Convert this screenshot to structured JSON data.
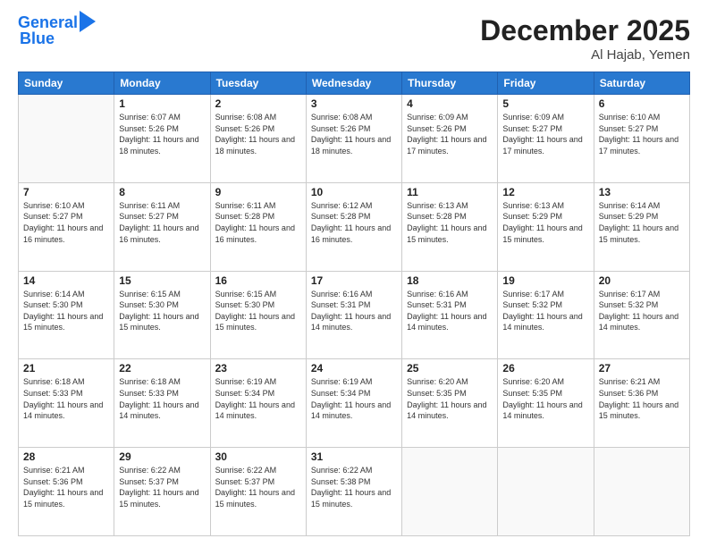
{
  "header": {
    "logo_line1": "General",
    "logo_line2": "Blue",
    "month": "December 2025",
    "location": "Al Hajab, Yemen"
  },
  "days_of_week": [
    "Sunday",
    "Monday",
    "Tuesday",
    "Wednesday",
    "Thursday",
    "Friday",
    "Saturday"
  ],
  "weeks": [
    [
      {
        "day": "",
        "info": ""
      },
      {
        "day": "1",
        "info": "Sunrise: 6:07 AM\nSunset: 5:26 PM\nDaylight: 11 hours and 18 minutes."
      },
      {
        "day": "2",
        "info": "Sunrise: 6:08 AM\nSunset: 5:26 PM\nDaylight: 11 hours and 18 minutes."
      },
      {
        "day": "3",
        "info": "Sunrise: 6:08 AM\nSunset: 5:26 PM\nDaylight: 11 hours and 18 minutes."
      },
      {
        "day": "4",
        "info": "Sunrise: 6:09 AM\nSunset: 5:26 PM\nDaylight: 11 hours and 17 minutes."
      },
      {
        "day": "5",
        "info": "Sunrise: 6:09 AM\nSunset: 5:27 PM\nDaylight: 11 hours and 17 minutes."
      },
      {
        "day": "6",
        "info": "Sunrise: 6:10 AM\nSunset: 5:27 PM\nDaylight: 11 hours and 17 minutes."
      }
    ],
    [
      {
        "day": "7",
        "info": "Sunrise: 6:10 AM\nSunset: 5:27 PM\nDaylight: 11 hours and 16 minutes."
      },
      {
        "day": "8",
        "info": "Sunrise: 6:11 AM\nSunset: 5:27 PM\nDaylight: 11 hours and 16 minutes."
      },
      {
        "day": "9",
        "info": "Sunrise: 6:11 AM\nSunset: 5:28 PM\nDaylight: 11 hours and 16 minutes."
      },
      {
        "day": "10",
        "info": "Sunrise: 6:12 AM\nSunset: 5:28 PM\nDaylight: 11 hours and 16 minutes."
      },
      {
        "day": "11",
        "info": "Sunrise: 6:13 AM\nSunset: 5:28 PM\nDaylight: 11 hours and 15 minutes."
      },
      {
        "day": "12",
        "info": "Sunrise: 6:13 AM\nSunset: 5:29 PM\nDaylight: 11 hours and 15 minutes."
      },
      {
        "day": "13",
        "info": "Sunrise: 6:14 AM\nSunset: 5:29 PM\nDaylight: 11 hours and 15 minutes."
      }
    ],
    [
      {
        "day": "14",
        "info": "Sunrise: 6:14 AM\nSunset: 5:30 PM\nDaylight: 11 hours and 15 minutes."
      },
      {
        "day": "15",
        "info": "Sunrise: 6:15 AM\nSunset: 5:30 PM\nDaylight: 11 hours and 15 minutes."
      },
      {
        "day": "16",
        "info": "Sunrise: 6:15 AM\nSunset: 5:30 PM\nDaylight: 11 hours and 15 minutes."
      },
      {
        "day": "17",
        "info": "Sunrise: 6:16 AM\nSunset: 5:31 PM\nDaylight: 11 hours and 14 minutes."
      },
      {
        "day": "18",
        "info": "Sunrise: 6:16 AM\nSunset: 5:31 PM\nDaylight: 11 hours and 14 minutes."
      },
      {
        "day": "19",
        "info": "Sunrise: 6:17 AM\nSunset: 5:32 PM\nDaylight: 11 hours and 14 minutes."
      },
      {
        "day": "20",
        "info": "Sunrise: 6:17 AM\nSunset: 5:32 PM\nDaylight: 11 hours and 14 minutes."
      }
    ],
    [
      {
        "day": "21",
        "info": "Sunrise: 6:18 AM\nSunset: 5:33 PM\nDaylight: 11 hours and 14 minutes."
      },
      {
        "day": "22",
        "info": "Sunrise: 6:18 AM\nSunset: 5:33 PM\nDaylight: 11 hours and 14 minutes."
      },
      {
        "day": "23",
        "info": "Sunrise: 6:19 AM\nSunset: 5:34 PM\nDaylight: 11 hours and 14 minutes."
      },
      {
        "day": "24",
        "info": "Sunrise: 6:19 AM\nSunset: 5:34 PM\nDaylight: 11 hours and 14 minutes."
      },
      {
        "day": "25",
        "info": "Sunrise: 6:20 AM\nSunset: 5:35 PM\nDaylight: 11 hours and 14 minutes."
      },
      {
        "day": "26",
        "info": "Sunrise: 6:20 AM\nSunset: 5:35 PM\nDaylight: 11 hours and 14 minutes."
      },
      {
        "day": "27",
        "info": "Sunrise: 6:21 AM\nSunset: 5:36 PM\nDaylight: 11 hours and 15 minutes."
      }
    ],
    [
      {
        "day": "28",
        "info": "Sunrise: 6:21 AM\nSunset: 5:36 PM\nDaylight: 11 hours and 15 minutes."
      },
      {
        "day": "29",
        "info": "Sunrise: 6:22 AM\nSunset: 5:37 PM\nDaylight: 11 hours and 15 minutes."
      },
      {
        "day": "30",
        "info": "Sunrise: 6:22 AM\nSunset: 5:37 PM\nDaylight: 11 hours and 15 minutes."
      },
      {
        "day": "31",
        "info": "Sunrise: 6:22 AM\nSunset: 5:38 PM\nDaylight: 11 hours and 15 minutes."
      },
      {
        "day": "",
        "info": ""
      },
      {
        "day": "",
        "info": ""
      },
      {
        "day": "",
        "info": ""
      }
    ]
  ]
}
